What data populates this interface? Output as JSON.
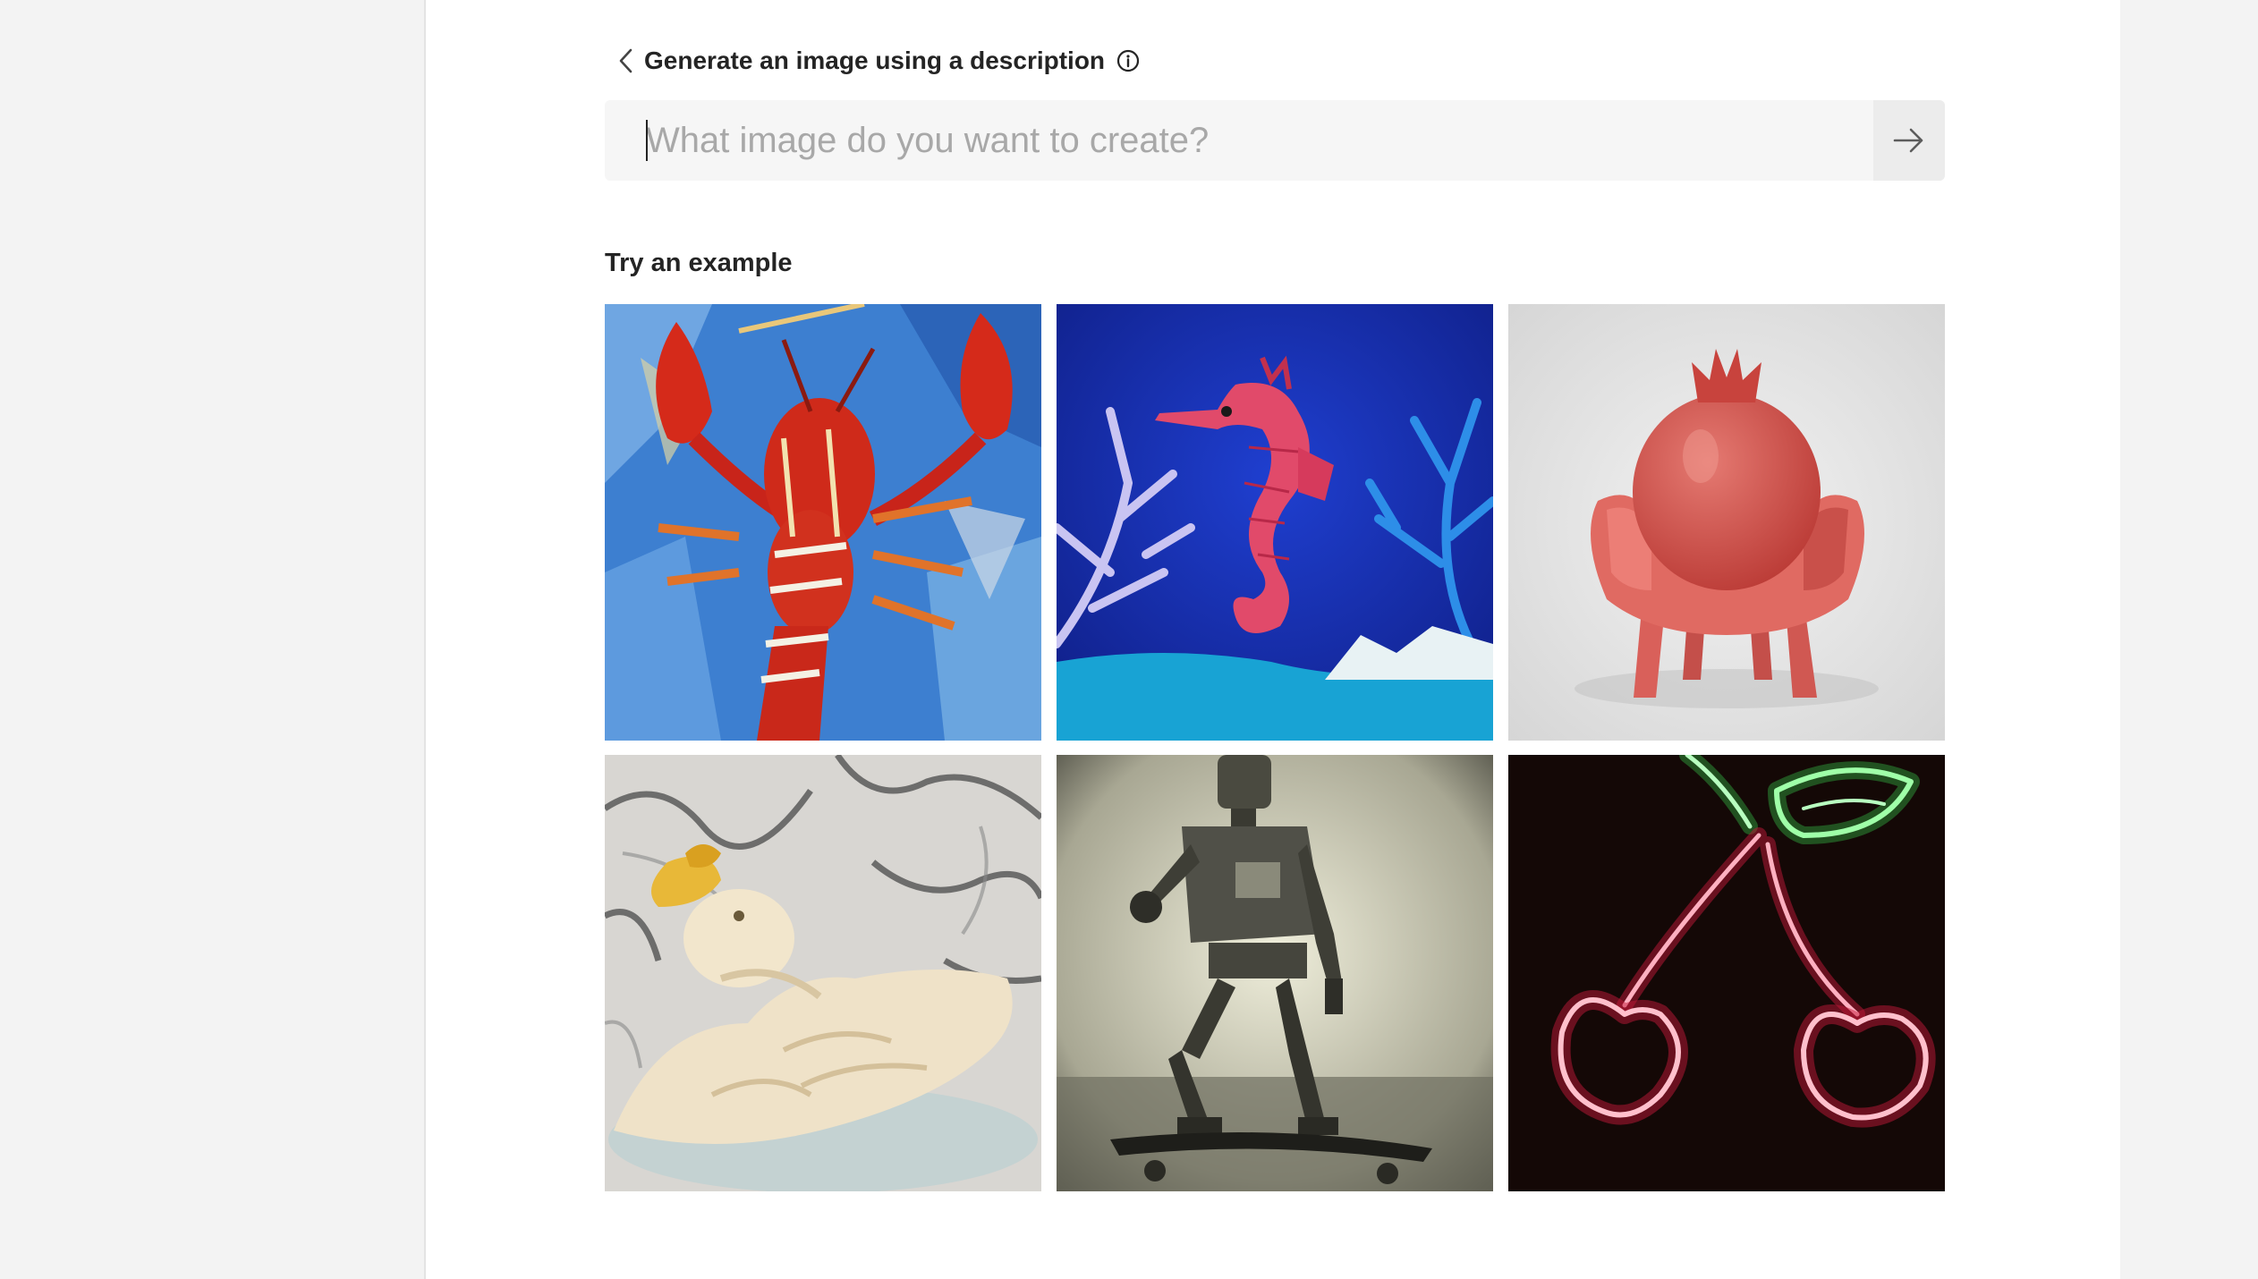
{
  "header": {
    "title": "Generate an image using a description",
    "back_icon": "chevron-left-icon",
    "info_icon": "info-icon"
  },
  "prompt": {
    "placeholder": "What image do you want to create?",
    "value": "",
    "submit_icon": "arrow-right-icon"
  },
  "examples": {
    "title": "Try an example",
    "items": [
      {
        "subject": "lobster-painting"
      },
      {
        "subject": "paper-seahorse"
      },
      {
        "subject": "pomegranate-chair"
      },
      {
        "subject": "marble-duck"
      },
      {
        "subject": "robot-skateboard"
      },
      {
        "subject": "neon-cherries"
      }
    ]
  },
  "colors": {
    "page_background": "#f3f3f3",
    "panel_background": "#ffffff",
    "prompt_background": "#f6f6f6",
    "submit_background": "#ececec",
    "text": "#242424",
    "placeholder": "#a8a8a8"
  }
}
